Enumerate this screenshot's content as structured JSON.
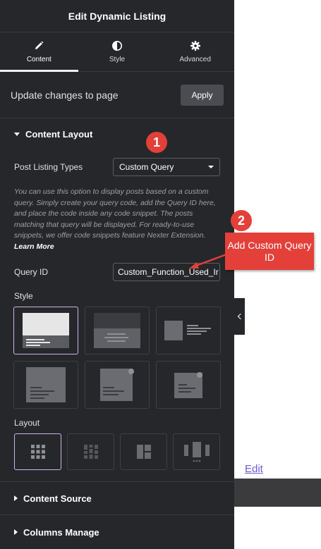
{
  "header": {
    "title": "Edit Dynamic Listing"
  },
  "tabs": [
    {
      "label": "Content",
      "icon": "pencil-icon",
      "active": true
    },
    {
      "label": "Style",
      "icon": "contrast-icon",
      "active": false
    },
    {
      "label": "Advanced",
      "icon": "gear-icon",
      "active": false
    }
  ],
  "update": {
    "text": "Update changes to page",
    "apply_label": "Apply"
  },
  "content_layout": {
    "title": "Content Layout",
    "post_listing_types_label": "Post Listing Types",
    "post_listing_types_value": "Custom Query",
    "description": "You can use this option to display posts based on a custom query. Simply create your query code, add the Query ID here, and place the code inside any code snippet. The posts matching that query will be displayed. For ready-to-use snippets, we offer code snippets feature Nexter Extension.",
    "learn_more": "Learn More",
    "query_id_label": "Query ID",
    "query_id_value": "Custom_Function_Used_Ir",
    "style_label": "Style",
    "layout_label": "Layout"
  },
  "sections": {
    "content_source": "Content Source",
    "columns_manage": "Columns Manage"
  },
  "preview": {
    "edit_link": "Edit"
  },
  "annotations": {
    "badge1": "1",
    "badge2": "2",
    "callout": "Add Custom Query ID"
  },
  "colors": {
    "panel_bg": "#26272b",
    "accent_selected": "#c9b5ea",
    "annotation_red": "#e3403a",
    "link": "#6b5bd6"
  }
}
